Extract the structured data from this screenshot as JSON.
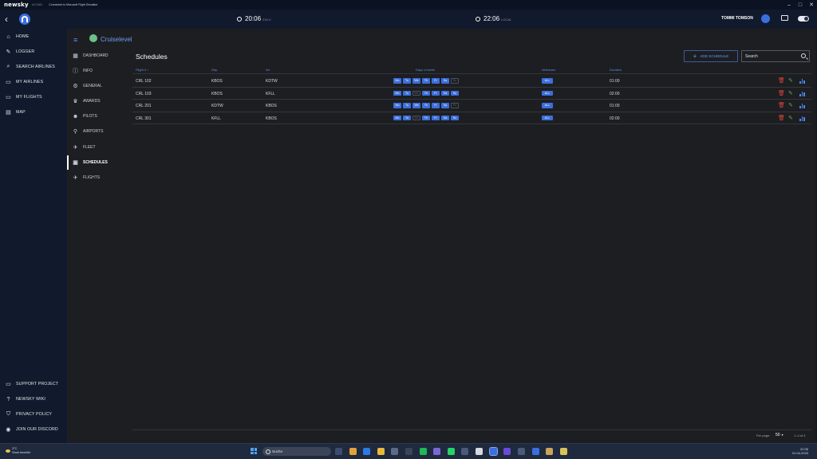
{
  "titlebar": {
    "app_name": "newsky",
    "version": "v0.0.361",
    "status": "Connected to Microsoft Flight Simulator"
  },
  "header": {
    "zulu_time": "20:06",
    "zulu_label": "ZULU",
    "local_time": "22:06",
    "local_label": "LOCAL",
    "user_name": "TOMMI TOMSON"
  },
  "sidebar": {
    "items": [
      {
        "label": "HOME",
        "icon": "home-icon"
      },
      {
        "label": "LOGGER",
        "icon": "pencil-icon"
      },
      {
        "label": "SEARCH AIRLINES",
        "icon": "search-icon"
      },
      {
        "label": "MY AIRLINES",
        "icon": "monitor-icon"
      },
      {
        "label": "MY FLIGHTS",
        "icon": "monitor-icon"
      },
      {
        "label": "MAP",
        "icon": "map-icon"
      }
    ],
    "bottom_items": [
      {
        "label": "SUPPORT PROJECT",
        "icon": "chat-icon"
      },
      {
        "label": "NEWSKY WIKI",
        "icon": "help-icon"
      },
      {
        "label": "PRIVACY POLICY",
        "icon": "shield-icon"
      },
      {
        "label": "JOIN OUR DISCORD",
        "icon": "discord-icon"
      }
    ]
  },
  "airline": {
    "name": "Cruiselevel"
  },
  "subnav": {
    "items": [
      {
        "label": "DASHBOARD",
        "icon": "dashboard-icon"
      },
      {
        "label": "INFO",
        "icon": "info-icon"
      },
      {
        "label": "GENERAL",
        "icon": "gear-icon"
      },
      {
        "label": "AWARDS",
        "icon": "trophy-icon"
      },
      {
        "label": "PILOTS",
        "icon": "people-icon"
      },
      {
        "label": "AIRPORTS",
        "icon": "pin-icon"
      },
      {
        "label": "FLEET",
        "icon": "plane-icon"
      },
      {
        "label": "SCHEDULES",
        "icon": "calendar-icon"
      },
      {
        "label": "FLIGHTS",
        "icon": "landing-icon"
      }
    ],
    "active": "SCHEDULES"
  },
  "page": {
    "title": "Schedules",
    "add_label": "ADD SCHEDULE",
    "search_placeholder": "Search"
  },
  "table": {
    "headers": {
      "flight": "Flight # ↑",
      "dep": "Dep",
      "arr": "Arr",
      "days": "Days of week",
      "airframes": "Airframes",
      "duration": "Duration"
    },
    "day_labels": [
      "Mo",
      "Tu",
      "We",
      "Th",
      "Fr",
      "Sa",
      "Su"
    ],
    "rows": [
      {
        "flight": "CRL 102",
        "dep": "KBOS",
        "arr": "KDTW",
        "days": [
          true,
          true,
          true,
          true,
          true,
          true,
          false
        ],
        "airframes": "ALL",
        "duration": "01:00"
      },
      {
        "flight": "CRL 103",
        "dep": "KBOS",
        "arr": "KFLL",
        "days": [
          true,
          true,
          false,
          true,
          true,
          true,
          true
        ],
        "airframes": "ALL",
        "duration": "02:00"
      },
      {
        "flight": "CRL 201",
        "dep": "KDTW",
        "arr": "KBOS",
        "days": [
          true,
          true,
          true,
          true,
          true,
          true,
          false
        ],
        "airframes": "ALL",
        "duration": "01:00"
      },
      {
        "flight": "CRL 301",
        "dep": "KFLL",
        "arr": "KBOS",
        "days": [
          true,
          true,
          false,
          true,
          true,
          true,
          true
        ],
        "airframes": "ALL",
        "duration": "02:00"
      }
    ]
  },
  "footer": {
    "per_page_label": "Per page:",
    "per_page_value": "50",
    "range": "1–4 of 4"
  },
  "taskbar": {
    "temperature": "3°C",
    "weather": "Stark bewölkt",
    "search_placeholder": "Suche",
    "time": "22:06",
    "date": "01.04.2023"
  },
  "colors": {
    "accent": "#3b6fdc",
    "link": "#6b9cf0",
    "delete": "#e0443a",
    "edit": "#56b04a",
    "sidebar_bg": "#111a2c",
    "panel_bg": "#1d1e22"
  }
}
